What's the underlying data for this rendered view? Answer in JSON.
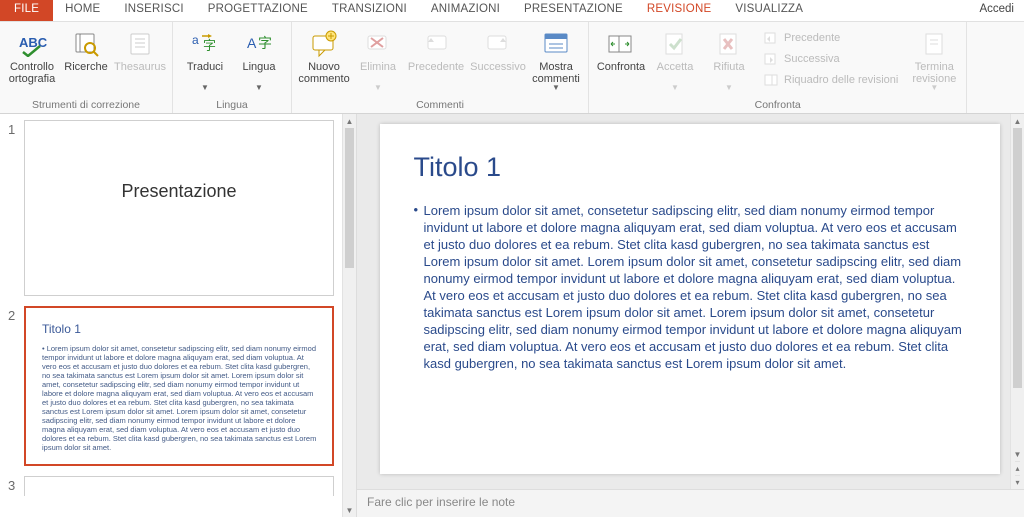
{
  "tabs": {
    "file": "FILE",
    "items": [
      "HOME",
      "INSERISCI",
      "PROGETTAZIONE",
      "TRANSIZIONI",
      "ANIMAZIONI",
      "PRESENTAZIONE",
      "REVISIONE",
      "VISUALIZZA"
    ],
    "active_index": 6,
    "accedi": "Accedi"
  },
  "ribbon": {
    "groups": [
      {
        "label": "Strumenti di correzione",
        "buttons": [
          {
            "label": "Controllo\nortografia",
            "icon": "spellcheck-icon",
            "enabled": true
          },
          {
            "label": "Ricerche",
            "icon": "research-icon",
            "enabled": true
          },
          {
            "label": "Thesaurus",
            "icon": "thesaurus-icon",
            "enabled": false
          }
        ]
      },
      {
        "label": "Lingua",
        "buttons": [
          {
            "label": "Traduci",
            "icon": "translate-icon",
            "enabled": true,
            "caret": true
          },
          {
            "label": "Lingua",
            "icon": "language-icon",
            "enabled": true,
            "caret": true
          }
        ]
      },
      {
        "label": "Commenti",
        "buttons": [
          {
            "label": "Nuovo\ncommento",
            "icon": "new-comment-icon",
            "enabled": true
          },
          {
            "label": "Elimina",
            "icon": "delete-comment-icon",
            "enabled": false,
            "caret": true
          },
          {
            "label": "Precedente",
            "icon": "prev-comment-icon",
            "enabled": false
          },
          {
            "label": "Successivo",
            "icon": "next-comment-icon",
            "enabled": false
          },
          {
            "label": "Mostra\ncommenti",
            "icon": "show-comments-icon",
            "enabled": true,
            "caret": true
          }
        ]
      },
      {
        "label": "Confronta",
        "buttons": [
          {
            "label": "Confronta",
            "icon": "compare-icon",
            "enabled": true
          },
          {
            "label": "Accetta",
            "icon": "accept-icon",
            "enabled": false,
            "caret": true
          },
          {
            "label": "Rifiuta",
            "icon": "reject-icon",
            "enabled": false,
            "caret": true
          }
        ],
        "side_items": [
          {
            "label": "Precedente",
            "icon": "prev-change-icon",
            "enabled": false
          },
          {
            "label": "Successiva",
            "icon": "next-change-icon",
            "enabled": false
          },
          {
            "label": "Riquadro delle revisioni",
            "icon": "revisions-pane-icon",
            "enabled": false
          }
        ],
        "end_button": {
          "label": "Termina\nrevisione",
          "icon": "end-review-icon",
          "enabled": false,
          "caret": true
        }
      }
    ]
  },
  "thumbnails": [
    {
      "num": "1",
      "title": "Presentazione",
      "title_style": "center",
      "body": "",
      "selected": false
    },
    {
      "num": "2",
      "title": "Titolo 1",
      "body": "• Lorem ipsum dolor sit amet, consetetur sadipscing elitr, sed diam nonumy eirmod tempor invidunt ut labore et dolore magna aliquyam erat, sed diam voluptua. At vero eos et accusam et justo duo dolores et ea rebum. Stet clita kasd gubergren, no sea takimata sanctus est Lorem ipsum dolor sit amet. Lorem ipsum dolor sit amet, consetetur sadipscing elitr, sed diam nonumy eirmod tempor invidunt ut labore et dolore magna aliquyam erat, sed diam voluptua. At vero eos et accusam et justo duo dolores et ea rebum. Stet clita kasd gubergren, no sea takimata sanctus est Lorem ipsum dolor sit amet. Lorem ipsum dolor sit amet, consetetur sadipscing elitr, sed diam nonumy eirmod tempor invidunt ut labore et dolore magna aliquyam erat, sed diam voluptua. At vero eos et accusam et justo duo dolores et ea rebum. Stet clita kasd gubergren, no sea takimata sanctus est Lorem ipsum dolor sit amet.",
      "selected": true
    },
    {
      "num": "3",
      "title": "",
      "body": "",
      "selected": false,
      "partial": true
    }
  ],
  "slide": {
    "title": "Titolo 1",
    "bullet": "•",
    "body": "Lorem ipsum dolor sit amet, consetetur sadipscing elitr, sed diam nonumy eirmod tempor invidunt ut labore et dolore magna aliquyam erat, sed diam voluptua. At vero eos et accusam et justo duo dolores et ea rebum. Stet clita kasd gubergren, no sea takimata sanctus est Lorem ipsum dolor sit amet. Lorem ipsum dolor sit amet, consetetur sadipscing elitr, sed diam nonumy eirmod tempor invidunt ut labore et dolore magna aliquyam erat, sed diam voluptua. At vero eos et accusam et justo duo dolores et ea rebum. Stet clita kasd gubergren, no sea takimata sanctus est Lorem ipsum dolor sit amet. Lorem ipsum dolor sit amet, consetetur sadipscing elitr, sed diam nonumy eirmod tempor invidunt ut labore et dolore magna aliquyam erat, sed diam voluptua. At vero eos et accusam et justo duo dolores et ea rebum. Stet clita kasd gubergren, no sea takimata sanctus est Lorem ipsum dolor sit amet."
  },
  "notes_placeholder": "Fare clic per inserire le note"
}
